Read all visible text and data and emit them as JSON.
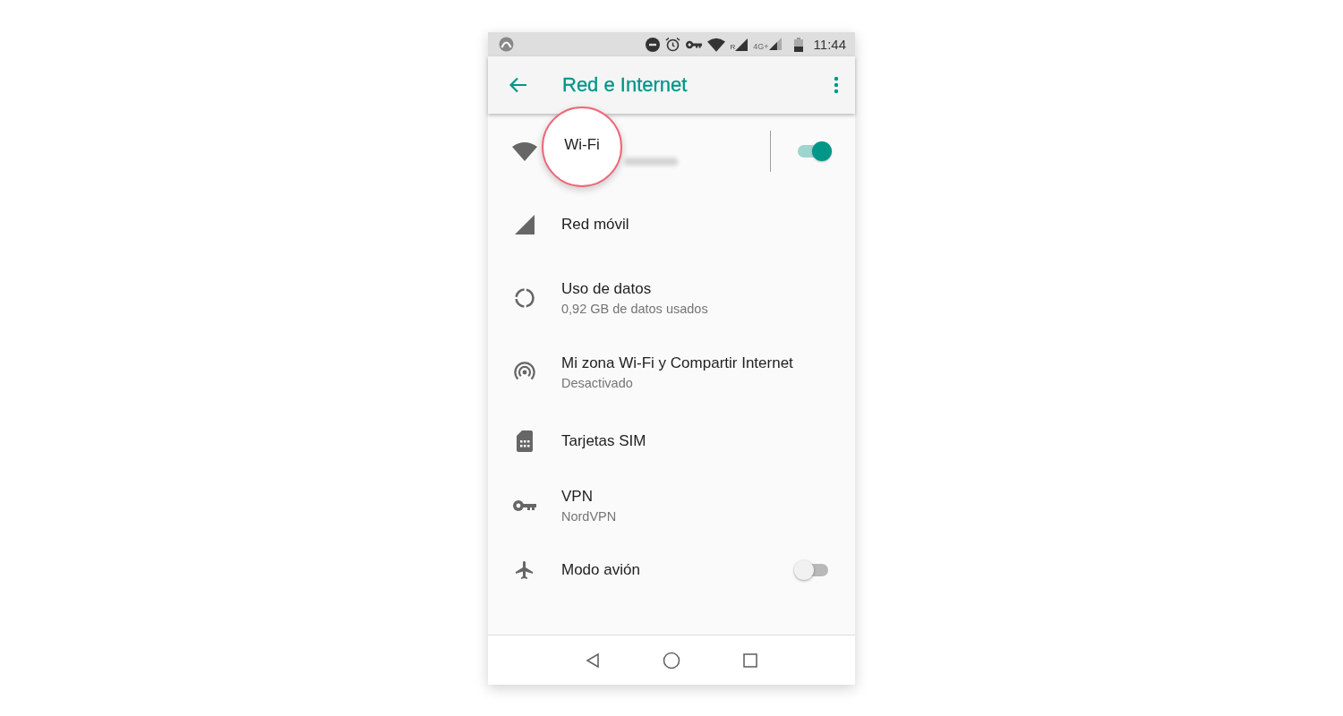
{
  "status_bar": {
    "roaming_label": "R",
    "network_type": "4G+",
    "time": "11:44"
  },
  "app_bar": {
    "title": "Red e Internet"
  },
  "items": [
    {
      "kind": "toggle",
      "title": "Wi-Fi",
      "highlighted": true,
      "on": true
    },
    {
      "kind": "link",
      "title": "Red móvil",
      "highlighted": false
    },
    {
      "kind": "link",
      "title": "Uso de datos",
      "subtitle": "0,92 GB de datos usados",
      "highlighted": false
    },
    {
      "kind": "link",
      "title": "Mi zona Wi-Fi y Compartir Internet",
      "subtitle": "Desactivado",
      "highlighted": false
    },
    {
      "kind": "link",
      "title": "Tarjetas SIM",
      "highlighted": false
    },
    {
      "kind": "link",
      "title": "VPN",
      "subtitle": "NordVPN",
      "highlighted": false
    },
    {
      "kind": "toggle",
      "title": "Modo avión",
      "highlighted": false,
      "on": false
    }
  ]
}
